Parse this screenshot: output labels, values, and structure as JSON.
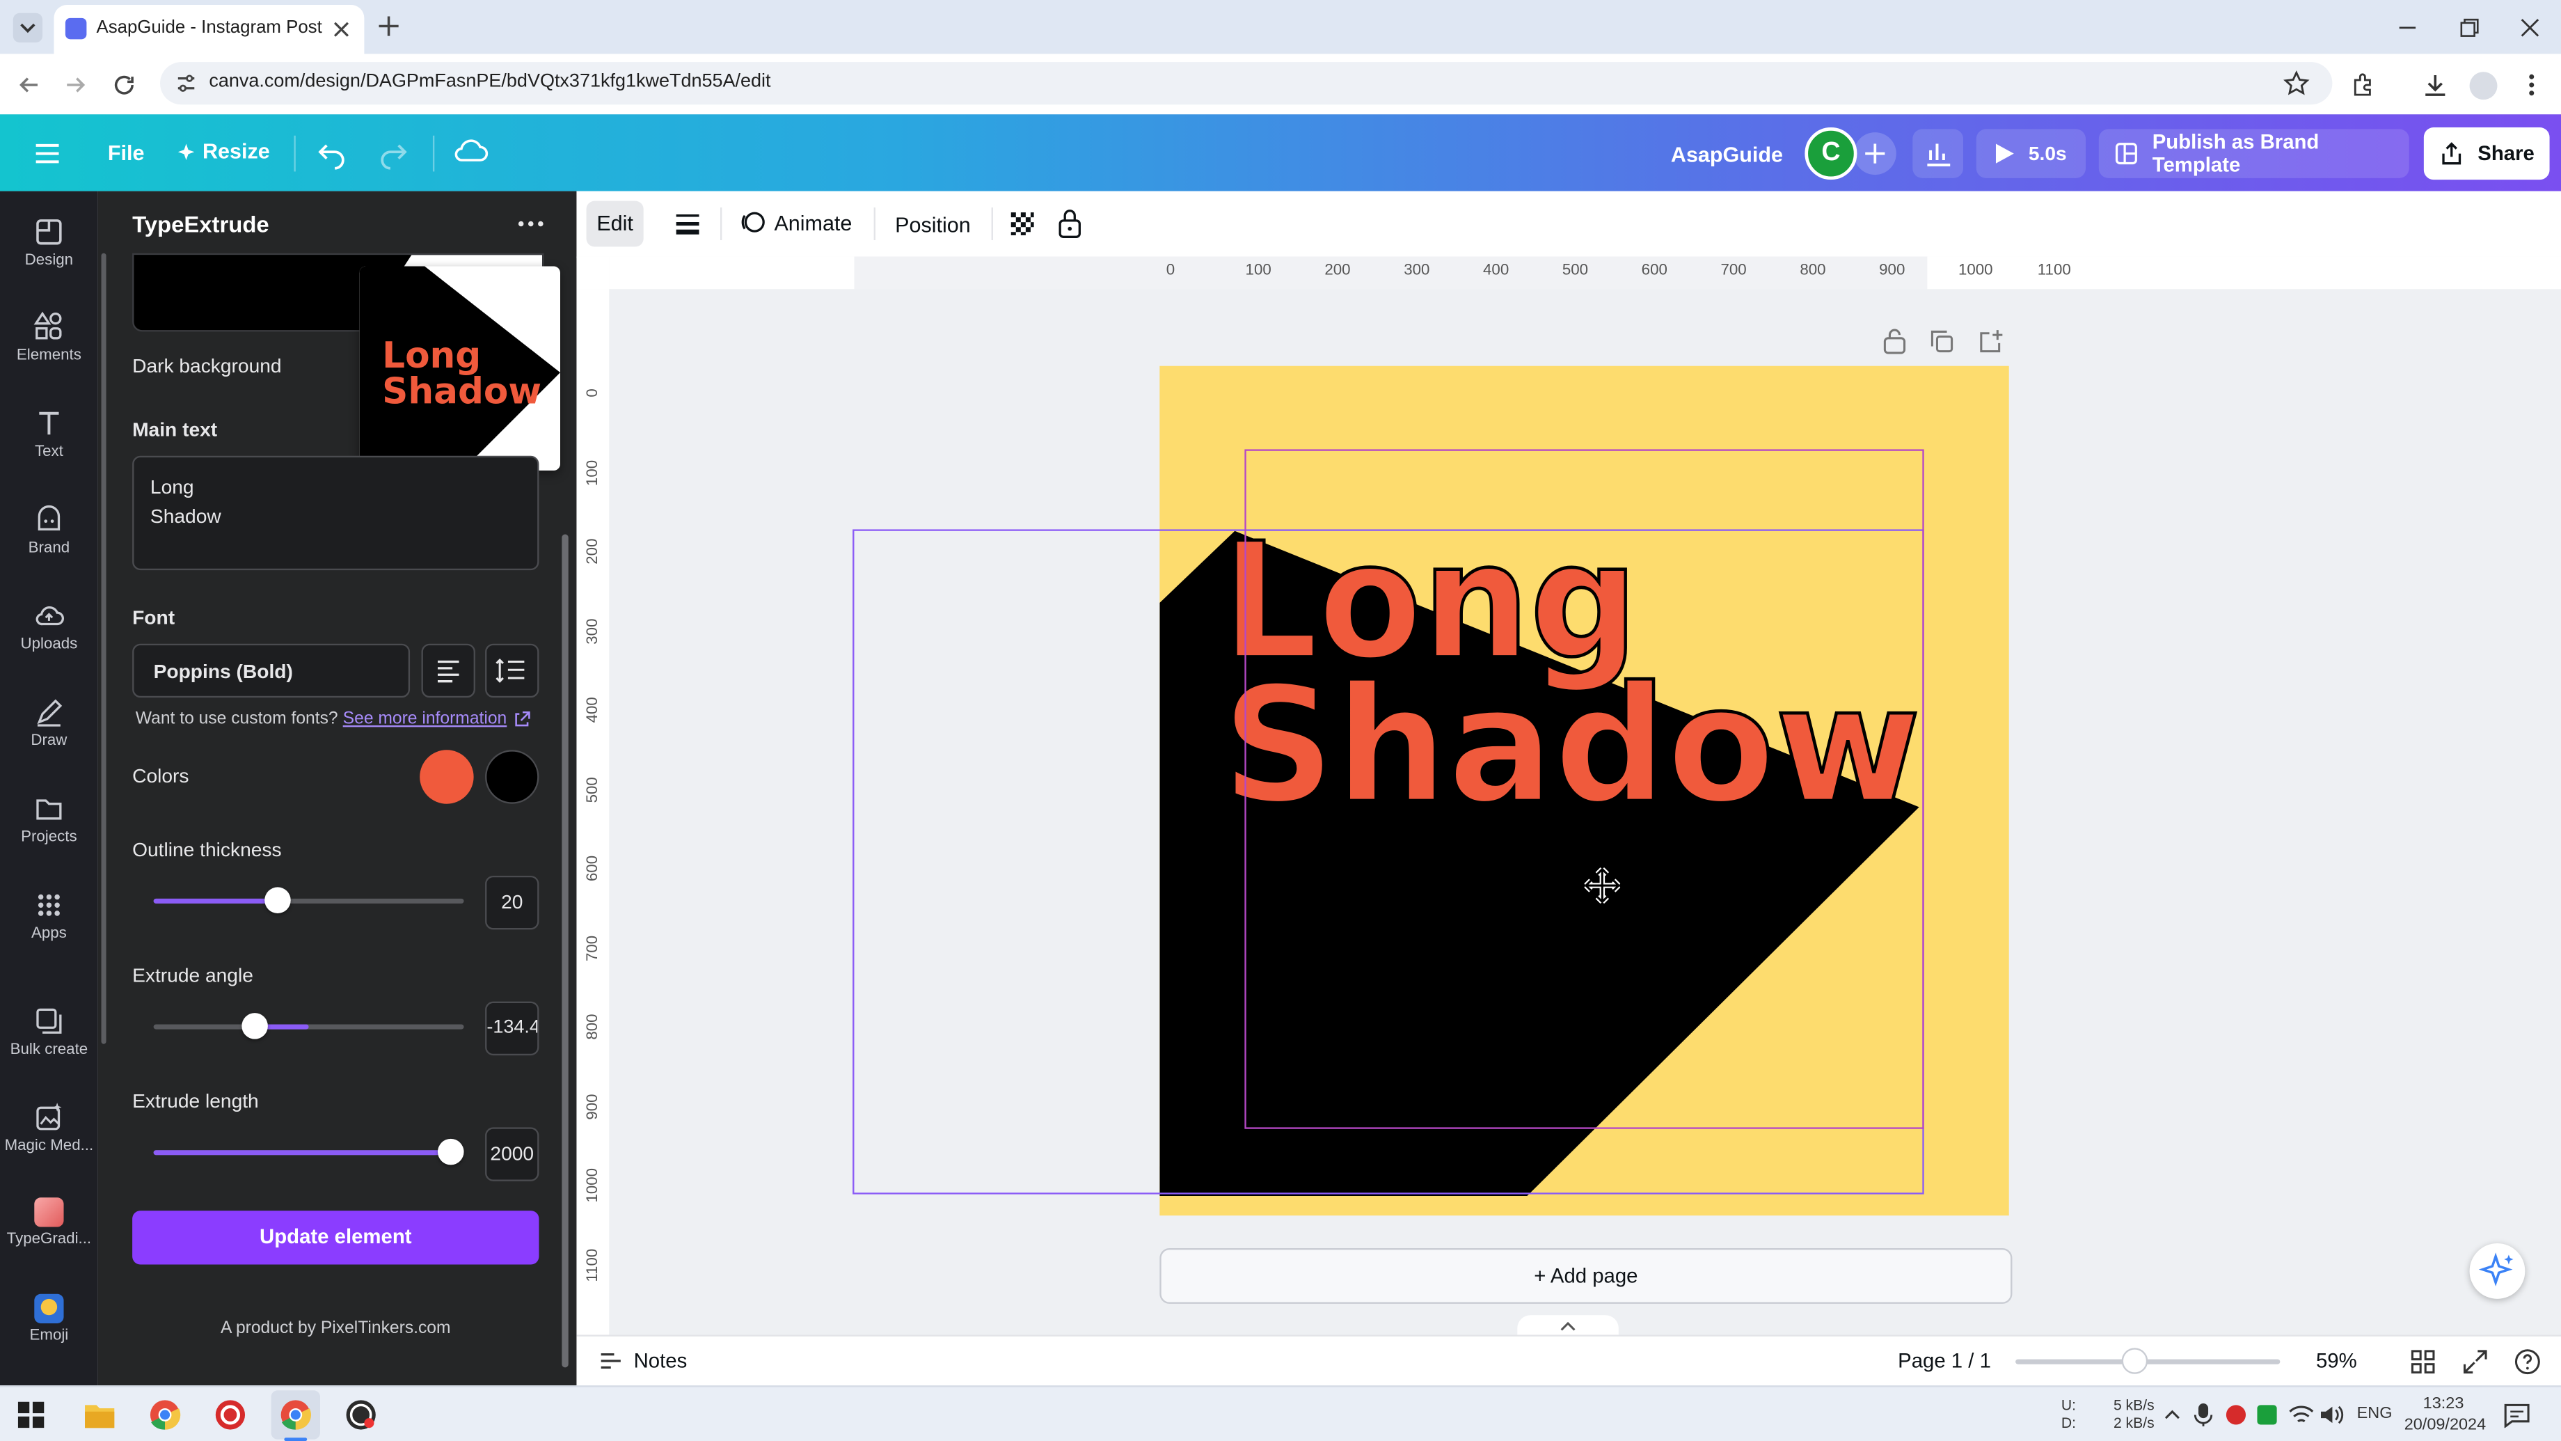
{
  "browser": {
    "tab_title": "AsapGuide - Instagram Post",
    "url": "canva.com/design/DAGPmFasnPE/bdVQtx371kfg1kweTdn55A/edit"
  },
  "header": {
    "file": "File",
    "resize": "Resize",
    "team_name": "AsapGuide",
    "avatar_letter": "C",
    "play_duration": "5.0s",
    "publish": "Publish as Brand Template",
    "share": "Share"
  },
  "rail": {
    "items": [
      "Design",
      "Elements",
      "Text",
      "Brand",
      "Uploads",
      "Draw",
      "Projects",
      "Apps",
      "Bulk create",
      "Magic Med...",
      "TypeGradi...",
      "Emoji"
    ]
  },
  "panel": {
    "title": "TypeExtrude",
    "dark_background_label": "Dark background",
    "preview_text_line1": "Long",
    "preview_text_line2": "Shadow",
    "main_text_label": "Main text",
    "main_text_value_line1": "Long",
    "main_text_value_line2": "Shadow",
    "font_label": "Font",
    "font_value": "Poppins (Bold)",
    "custom_fonts_text": "Want to use custom fonts?",
    "custom_fonts_link": "See more information",
    "colors_label": "Colors",
    "color_primary": "#f05a3c",
    "color_secondary": "#000000",
    "outline_label": "Outline thickness",
    "outline_value": "20",
    "outline_fraction": 0.4,
    "angle_label": "Extrude angle",
    "angle_value": "-134.4",
    "length_label": "Extrude length",
    "length_value": "2000",
    "length_fraction": 1.0,
    "update_button": "Update element",
    "footer": "A product by PixelTinkers.com"
  },
  "toolbar": {
    "edit": "Edit",
    "animate": "Animate",
    "position": "Position"
  },
  "ruler": {
    "top": [
      "0",
      "100",
      "200",
      "300",
      "400",
      "500",
      "600",
      "700",
      "800",
      "900",
      "1000",
      "1100"
    ],
    "left": [
      "0",
      "100",
      "200",
      "300",
      "400",
      "500",
      "600",
      "700",
      "800",
      "900",
      "1000",
      "1100"
    ]
  },
  "canvas": {
    "background": "#fddc6e",
    "line1": "Long",
    "line2": "Shadow",
    "add_page": "+ Add page"
  },
  "footer": {
    "notes": "Notes",
    "page": "Page 1 / 1",
    "zoom": "59%",
    "zoom_fraction": 0.45
  },
  "taskbar": {
    "net_up_label": "U:",
    "net_down_label": "D:",
    "net_up": "5 kB/s",
    "net_down": "2 kB/s",
    "lang": "ENG",
    "time": "13:23",
    "date": "20/09/2024"
  }
}
